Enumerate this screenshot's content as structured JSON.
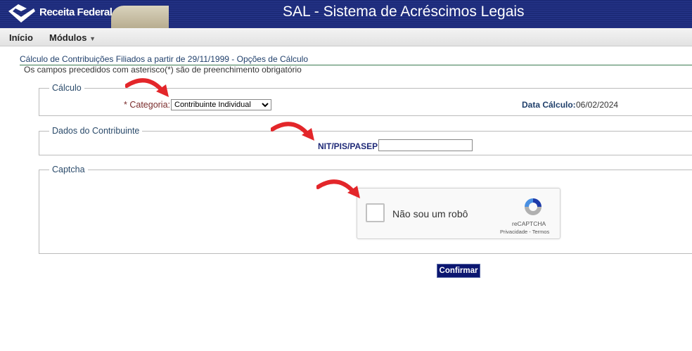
{
  "header": {
    "brand": "Receita Federal",
    "title": "SAL - Sistema de Acréscimos Legais"
  },
  "menu": {
    "inicio": "Início",
    "modulos": "Módulos"
  },
  "page": {
    "title": "Cálculo de Contribuições Filiados a partir de 29/11/1999 - Opções de Cálculo",
    "note": "Os campos precedidos com asterisco(*) são de preenchimento obrigatório"
  },
  "calculo": {
    "legend": "Cálculo",
    "categoria_label": "* Categoria:",
    "categoria_value": "Contribuinte Individual",
    "data_label": "Data Cálculo:",
    "data_value": "06/02/2024"
  },
  "contribuinte": {
    "legend": "Dados do Contribuinte",
    "nit_label": "NIT/PIS/PASEP:",
    "nit_value": ""
  },
  "captcha": {
    "legend": "Captcha",
    "checkbox_label": "Não sou um robô",
    "brand": "reCAPTCHA",
    "links": "Privacidade - Termos"
  },
  "actions": {
    "confirm": "Confirmar"
  },
  "colors": {
    "header": "#1c2a78",
    "button": "#0b1670",
    "arrow": "#e3262a"
  }
}
